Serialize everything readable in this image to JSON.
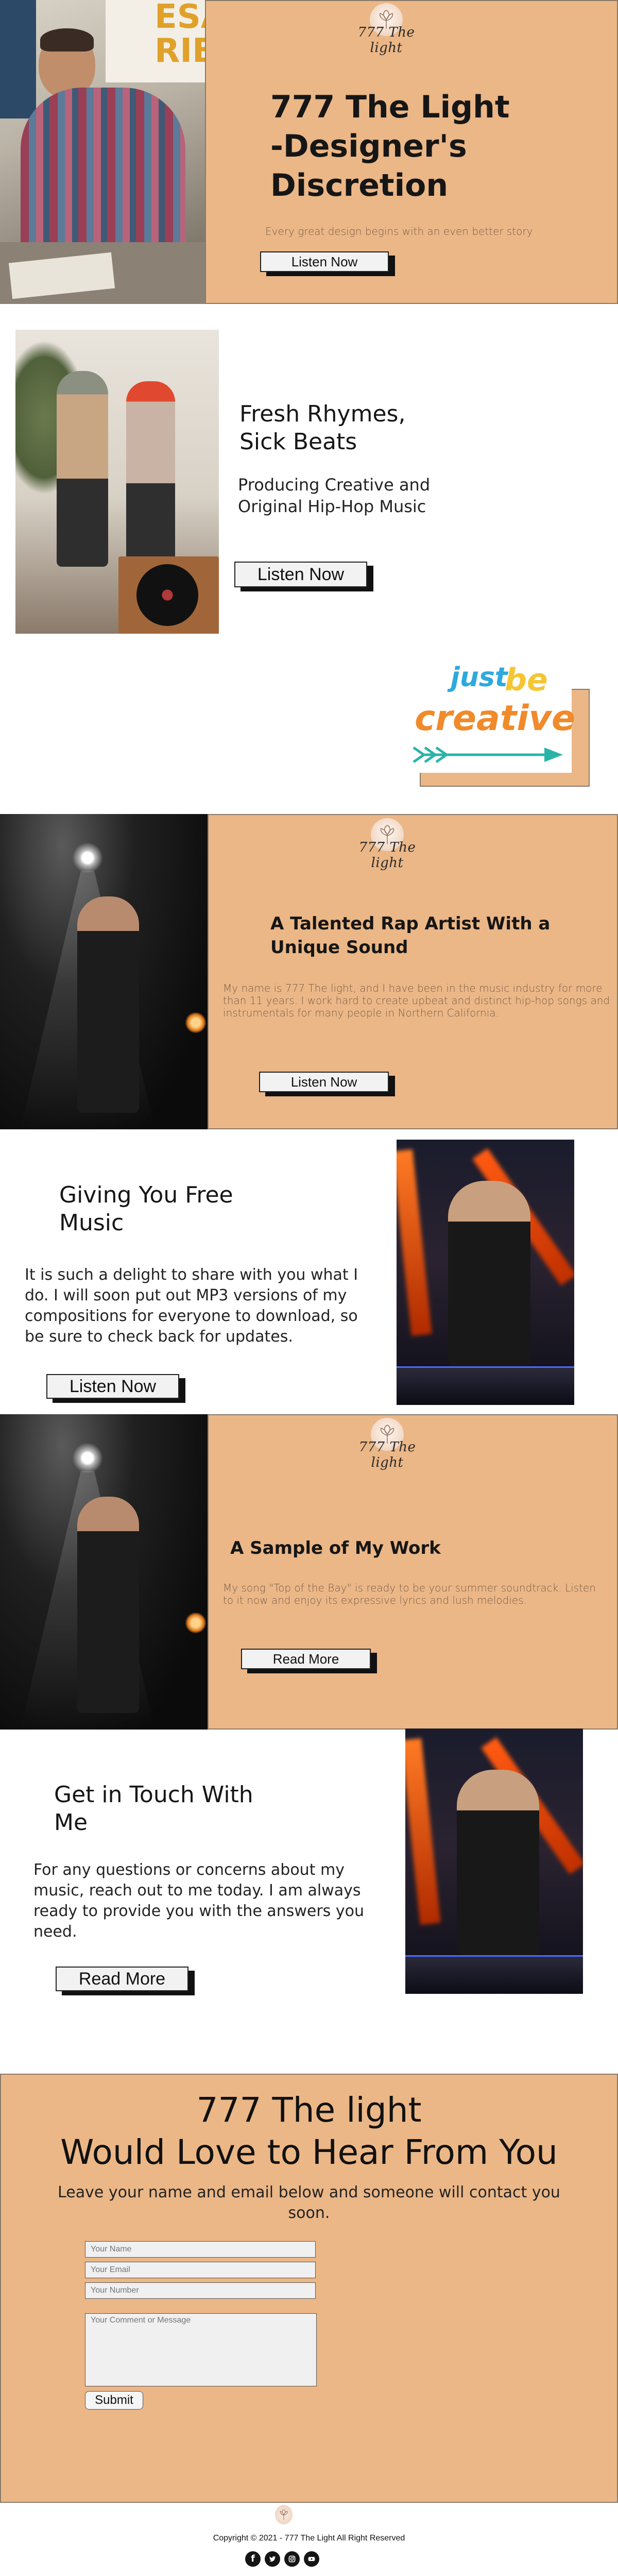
{
  "hero": {
    "brand": "777 The light",
    "title_line1": "777 The Light",
    "title_line2": "-Designer's",
    "title_line3": "Discretion",
    "subtitle": "Every great design begins with an even better story",
    "button": "Listen Now",
    "photo_sign_text": "ESA\nRIB"
  },
  "fresh": {
    "title_line1": "Fresh Rhymes,",
    "title_line2": "Sick Beats",
    "subtitle_line1": "Producing Creative and",
    "subtitle_line2": "Original Hip-Hop Music",
    "button": "Listen Now"
  },
  "creative": {
    "word1": "just",
    "word2": "be",
    "word3": "creative"
  },
  "talented": {
    "brand": "777 The light",
    "title_line1": "A Talented Rap Artist With a",
    "title_line2": "Unique Sound",
    "body": "My name is 777 The light, and I have been in the music industry for more than 11 years. I work hard to create upbeat and distinct hip-hop songs and instrumentals for many people in Northern California.",
    "button": "Listen Now"
  },
  "free": {
    "title_line1": "Giving You Free",
    "title_line2": "Music",
    "body": "It is such a delight to share with you what I do. I will soon put out MP3 versions of my compositions for everyone to download, so be sure to check back for updates.",
    "button": "Listen Now"
  },
  "sample": {
    "brand": "777 The light",
    "title": "A Sample of My Work",
    "body": "My song \"Top of the Bay\" is ready to be your summer soundtrack. Listen to it now and enjoy its expressive lyrics and lush melodies.",
    "button": "Read More"
  },
  "touch": {
    "title_line1": "Get in Touch With",
    "title_line2": "Me",
    "body": "For any questions or concerns about my music, reach out to me today. I am always ready to provide you with the answers you need.",
    "button": "Read More"
  },
  "contact": {
    "title_line1": "777 The light",
    "title_line2": "Would Love to Hear From You",
    "subtitle": "Leave your name and email below and someone will contact you soon.",
    "name_placeholder": "Your Name",
    "email_placeholder": "Your Email",
    "number_placeholder": "Your Number",
    "comment_placeholder": "Your Comment or Message",
    "submit": "Submit"
  },
  "footer": {
    "copyright": "Copyright © 2021 - 777 The Light All Right Reserved",
    "social_icons": [
      "facebook-icon",
      "twitter-icon",
      "instagram-icon",
      "youtube-icon"
    ]
  },
  "colors": {
    "peach": "#ebb787",
    "peach_text": "#7a5d45"
  }
}
